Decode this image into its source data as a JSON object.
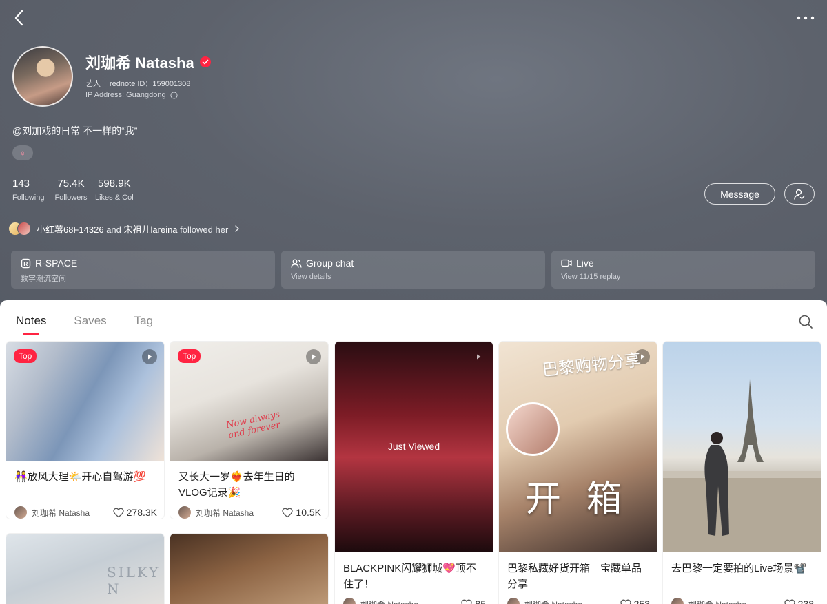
{
  "profile": {
    "name": "刘珈希 Natasha",
    "category": "艺人",
    "rednote_id": "rednote ID：159001308",
    "ip_address": "IP Address: Guangdong",
    "bio": "@刘加戏的日常 不一样的“我”",
    "gender_symbol": "♀"
  },
  "stats": [
    {
      "num": "143",
      "label": "Following"
    },
    {
      "num": "75.4K",
      "label": "Followers"
    },
    {
      "num": "598.9K",
      "label": "Likes & Col"
    }
  ],
  "actions": {
    "message_label": "Message"
  },
  "followed": {
    "user1": "小红薯68F14326",
    "and": "and",
    "user2": "宋祖儿lareina",
    "suffix": "followed her"
  },
  "cards": [
    {
      "title": "R-SPACE",
      "subtitle": "数字潮流空间"
    },
    {
      "title": "Group chat",
      "subtitle": "View details"
    },
    {
      "title": "Live",
      "subtitle": "View 11/15 replay"
    }
  ],
  "tabs": [
    "Notes",
    "Saves",
    "Tag"
  ],
  "badge_top_label": "Top",
  "just_viewed_label": "Just Viewed",
  "notes": [
    {
      "title": "👭放风大理🌤️开心自驾游💯",
      "author": "刘珈希 Natasha",
      "likes": "278.3K",
      "top": true
    },
    {
      "title": "又长大一岁❤️‍🔥去年生日的VLOG记录🎉",
      "author": "刘珈希 Natasha",
      "likes": "10.5K",
      "top": true
    },
    {
      "title": "BLACKPINK闪耀狮城💖顶不住了！",
      "author": "刘珈希 Natasha",
      "likes": "85"
    },
    {
      "title": "巴黎私藏好货开箱｜宝藏单品分享",
      "author": "刘珈希 Natasha",
      "likes": "253"
    },
    {
      "title": "去巴黎一定要拍的Live场景📽️",
      "author": "刘珈希 Natasha",
      "likes": "238"
    }
  ],
  "image_text": {
    "note2_overlay": "Now always and forever",
    "note4_header": "巴黎购物分享",
    "note4_big": "开 箱",
    "note6_sign": "SILKY N"
  }
}
